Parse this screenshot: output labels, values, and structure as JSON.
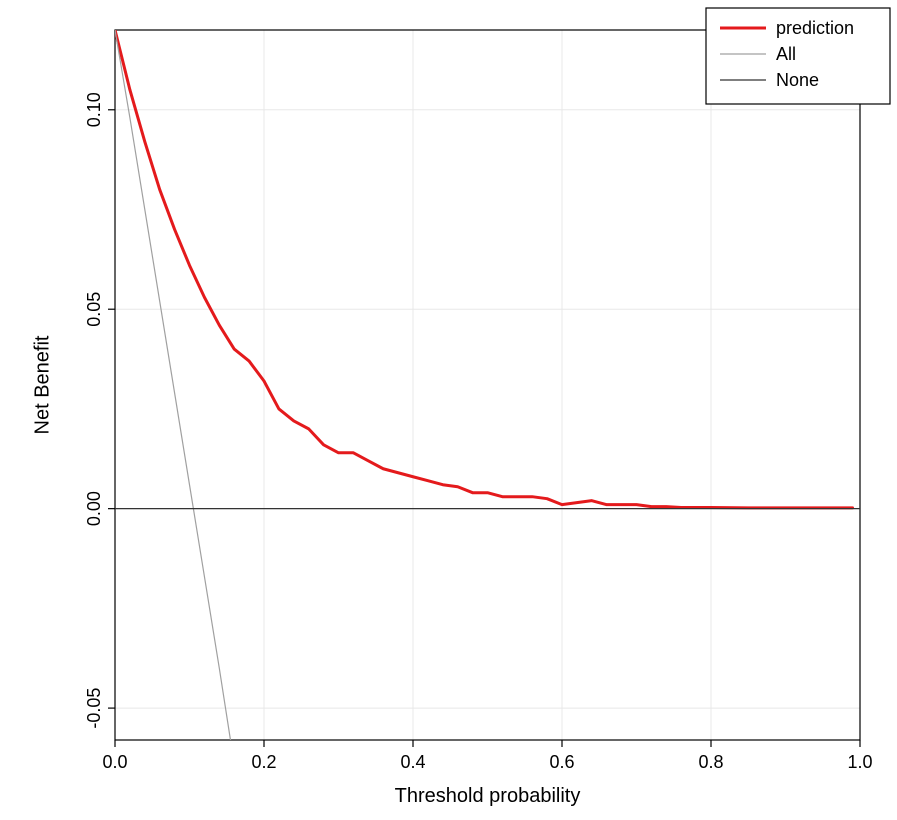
{
  "chart_data": {
    "type": "line",
    "xlabel": "Threshold probability",
    "ylabel": "Net Benefit",
    "xlim": [
      0.0,
      1.0
    ],
    "ylim": [
      -0.058,
      0.12
    ],
    "x_ticks": [
      0.0,
      0.2,
      0.4,
      0.6,
      0.8,
      1.0
    ],
    "y_ticks": [
      -0.05,
      0.0,
      0.05,
      0.1
    ],
    "grid": true,
    "legend_position": "top-right",
    "series": [
      {
        "name": "prediction",
        "color": "#e41a1c",
        "width": 3.0,
        "x": [
          0.0,
          0.02,
          0.04,
          0.06,
          0.08,
          0.1,
          0.12,
          0.14,
          0.16,
          0.18,
          0.2,
          0.22,
          0.24,
          0.26,
          0.28,
          0.3,
          0.32,
          0.34,
          0.36,
          0.38,
          0.4,
          0.42,
          0.44,
          0.46,
          0.48,
          0.5,
          0.52,
          0.54,
          0.56,
          0.58,
          0.6,
          0.62,
          0.64,
          0.66,
          0.68,
          0.7,
          0.72,
          0.74,
          0.76,
          0.78,
          0.8,
          0.85,
          0.9,
          0.95,
          0.99
        ],
        "y": [
          0.12,
          0.105,
          0.092,
          0.08,
          0.07,
          0.061,
          0.053,
          0.046,
          0.04,
          0.037,
          0.032,
          0.025,
          0.022,
          0.02,
          0.016,
          0.014,
          0.014,
          0.012,
          0.01,
          0.009,
          0.008,
          0.007,
          0.006,
          0.0055,
          0.004,
          0.004,
          0.003,
          0.003,
          0.003,
          0.0025,
          0.001,
          0.0015,
          0.002,
          0.001,
          0.001,
          0.001,
          0.0005,
          0.0005,
          0.0003,
          0.0003,
          0.0003,
          0.0002,
          0.0002,
          0.0002,
          0.0002
        ]
      },
      {
        "name": "All",
        "color": "#a0a0a0",
        "width": 1.2,
        "x": [
          0.0,
          0.02,
          0.04,
          0.06,
          0.08,
          0.1,
          0.12,
          0.14,
          0.155
        ],
        "y": [
          0.12,
          0.098,
          0.075,
          0.052,
          0.029,
          0.006,
          -0.017,
          -0.04,
          -0.058
        ]
      },
      {
        "name": "None",
        "color": "#333333",
        "width": 1.2,
        "x": [
          0.0,
          1.0
        ],
        "y": [
          0.0,
          0.0
        ]
      }
    ]
  },
  "legend": {
    "items": [
      {
        "label": "prediction",
        "color": "#e41a1c",
        "width": 3.0
      },
      {
        "label": "All",
        "color": "#a0a0a0",
        "width": 1.2
      },
      {
        "label": "None",
        "color": "#333333",
        "width": 1.2
      }
    ]
  }
}
